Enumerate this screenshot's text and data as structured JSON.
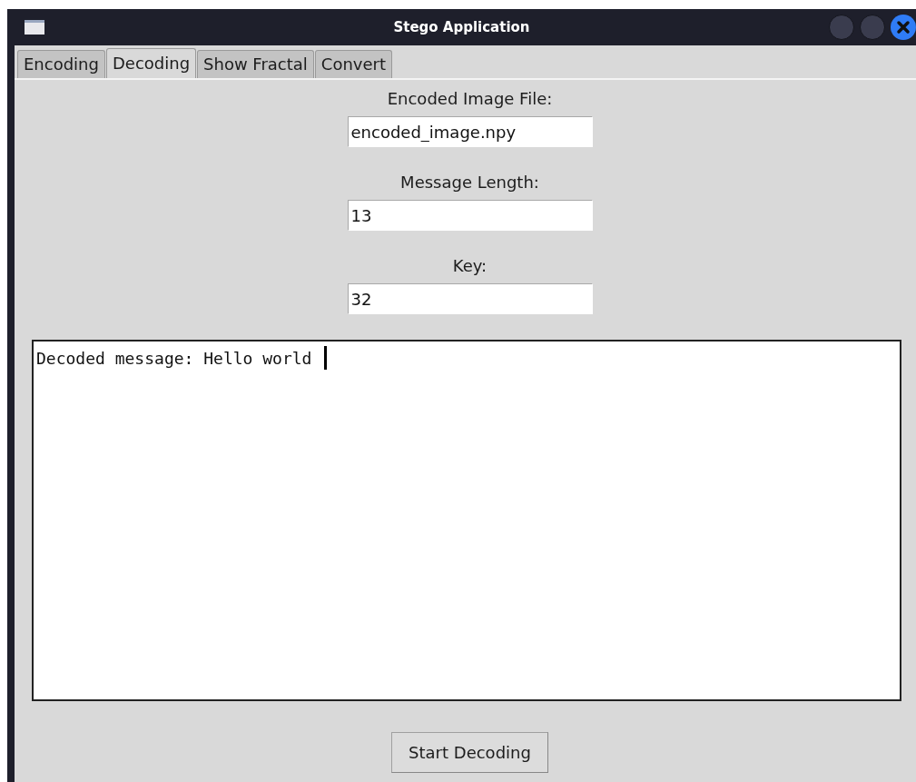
{
  "window": {
    "title": "Stego Application"
  },
  "tabs": [
    {
      "label": "Encoding",
      "selected": false
    },
    {
      "label": "Decoding",
      "selected": true
    },
    {
      "label": "Show Fractal",
      "selected": false
    },
    {
      "label": "Convert",
      "selected": false
    }
  ],
  "fields": [
    {
      "label": "Encoded Image File:",
      "value": "encoded_image.npy"
    },
    {
      "label": "Message Length:",
      "value": "13"
    },
    {
      "label": "Key:",
      "value": "32"
    }
  ],
  "output": {
    "text": "Decoded message: Hello world",
    "focused": true
  },
  "button": {
    "label": "Start Decoding"
  }
}
